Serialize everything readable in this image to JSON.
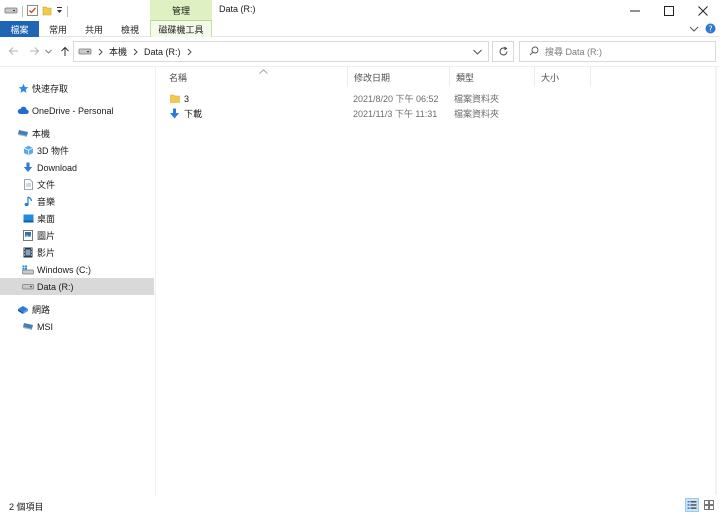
{
  "window": {
    "title": "Data (R:)",
    "context_tab_group": "管理"
  },
  "ribbon": {
    "tabs": [
      {
        "label": "檔案"
      },
      {
        "label": "常用"
      },
      {
        "label": "共用"
      },
      {
        "label": "檢視"
      },
      {
        "label": "磁碟機工具"
      }
    ]
  },
  "address": {
    "crumbs": [
      "本機",
      "Data (R:)"
    ],
    "search_placeholder": "搜尋 Data (R:)"
  },
  "nav": {
    "items": [
      {
        "label": "快速存取",
        "icon": "star-icon"
      },
      {
        "label": "OneDrive - Personal",
        "icon": "cloud-icon"
      },
      {
        "label": "本機",
        "icon": "computer-icon"
      },
      {
        "label": "3D 物件",
        "icon": "cube-icon"
      },
      {
        "label": "Download",
        "icon": "download-arrow-icon"
      },
      {
        "label": "文件",
        "icon": "document-icon"
      },
      {
        "label": "音樂",
        "icon": "music-note-icon"
      },
      {
        "label": "桌面",
        "icon": "desktop-icon"
      },
      {
        "label": "圖片",
        "icon": "pictures-icon"
      },
      {
        "label": "影片",
        "icon": "film-icon"
      },
      {
        "label": "Windows (C:)",
        "icon": "windows-drive-icon"
      },
      {
        "label": "Data (R:)",
        "icon": "drive-icon"
      },
      {
        "label": "網路",
        "icon": "network-icon"
      },
      {
        "label": "MSI",
        "icon": "network-computer-icon"
      }
    ]
  },
  "columns": {
    "name": "名稱",
    "modified": "修改日期",
    "type": "類型",
    "size": "大小"
  },
  "files": [
    {
      "name": "3",
      "modified": "2021/8/20 下午 06:52",
      "type": "檔案資料夾",
      "icon": "folder-icon"
    },
    {
      "name": "下載",
      "modified": "2021/11/3 下午 11:31",
      "type": "檔案資料夾",
      "icon": "download-folder-icon"
    }
  ],
  "status": {
    "item_count": "2 個項目"
  },
  "colors": {
    "file_tab": "#1e65b5",
    "context_tab": "#dff0c2",
    "selection": "#d9d9d9"
  }
}
